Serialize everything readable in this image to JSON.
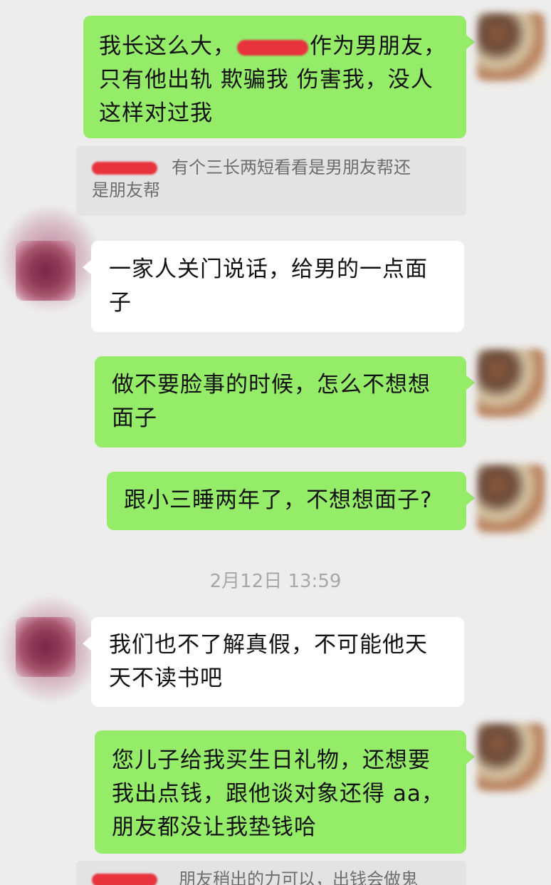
{
  "colors": {
    "background": "#ededed",
    "self_bubble": "#95ec69",
    "other_bubble": "#ffffff",
    "quote_bg": "#e3e3e3",
    "redaction": "#e8323c"
  },
  "messages": [
    {
      "sender": "self",
      "lines": [
        "我长这么大，",
        "作为男朋友，",
        "只有他出轨 欺骗我 伤害我，没人",
        "这样对过我"
      ]
    },
    {
      "sender": "quote",
      "lines": [
        "有个三长两短看看是男朋友帮还",
        "是朋友帮"
      ]
    },
    {
      "sender": "other",
      "lines": [
        "一家人关门说话，给男的一点面",
        "子"
      ]
    },
    {
      "sender": "self",
      "lines": [
        "做不要脸事的时候，怎么不想想",
        "面子"
      ]
    },
    {
      "sender": "self",
      "lines": [
        "跟小三睡两年了，不想想面子?"
      ]
    },
    {
      "sender": "other",
      "lines": [
        "我们也不了解真假，不可能他天",
        "天不读书吧"
      ]
    },
    {
      "sender": "self",
      "lines": [
        "您儿子给我买生日礼物，还想要",
        "我出点钱，跟他谈对象还得 aa，",
        "朋友都没让我垫钱哈"
      ]
    },
    {
      "sender": "quote",
      "lines": [
        "朋友稍出的力可以，出钱会做鬼"
      ]
    }
  ],
  "timestamp": "2月12日 13:59"
}
